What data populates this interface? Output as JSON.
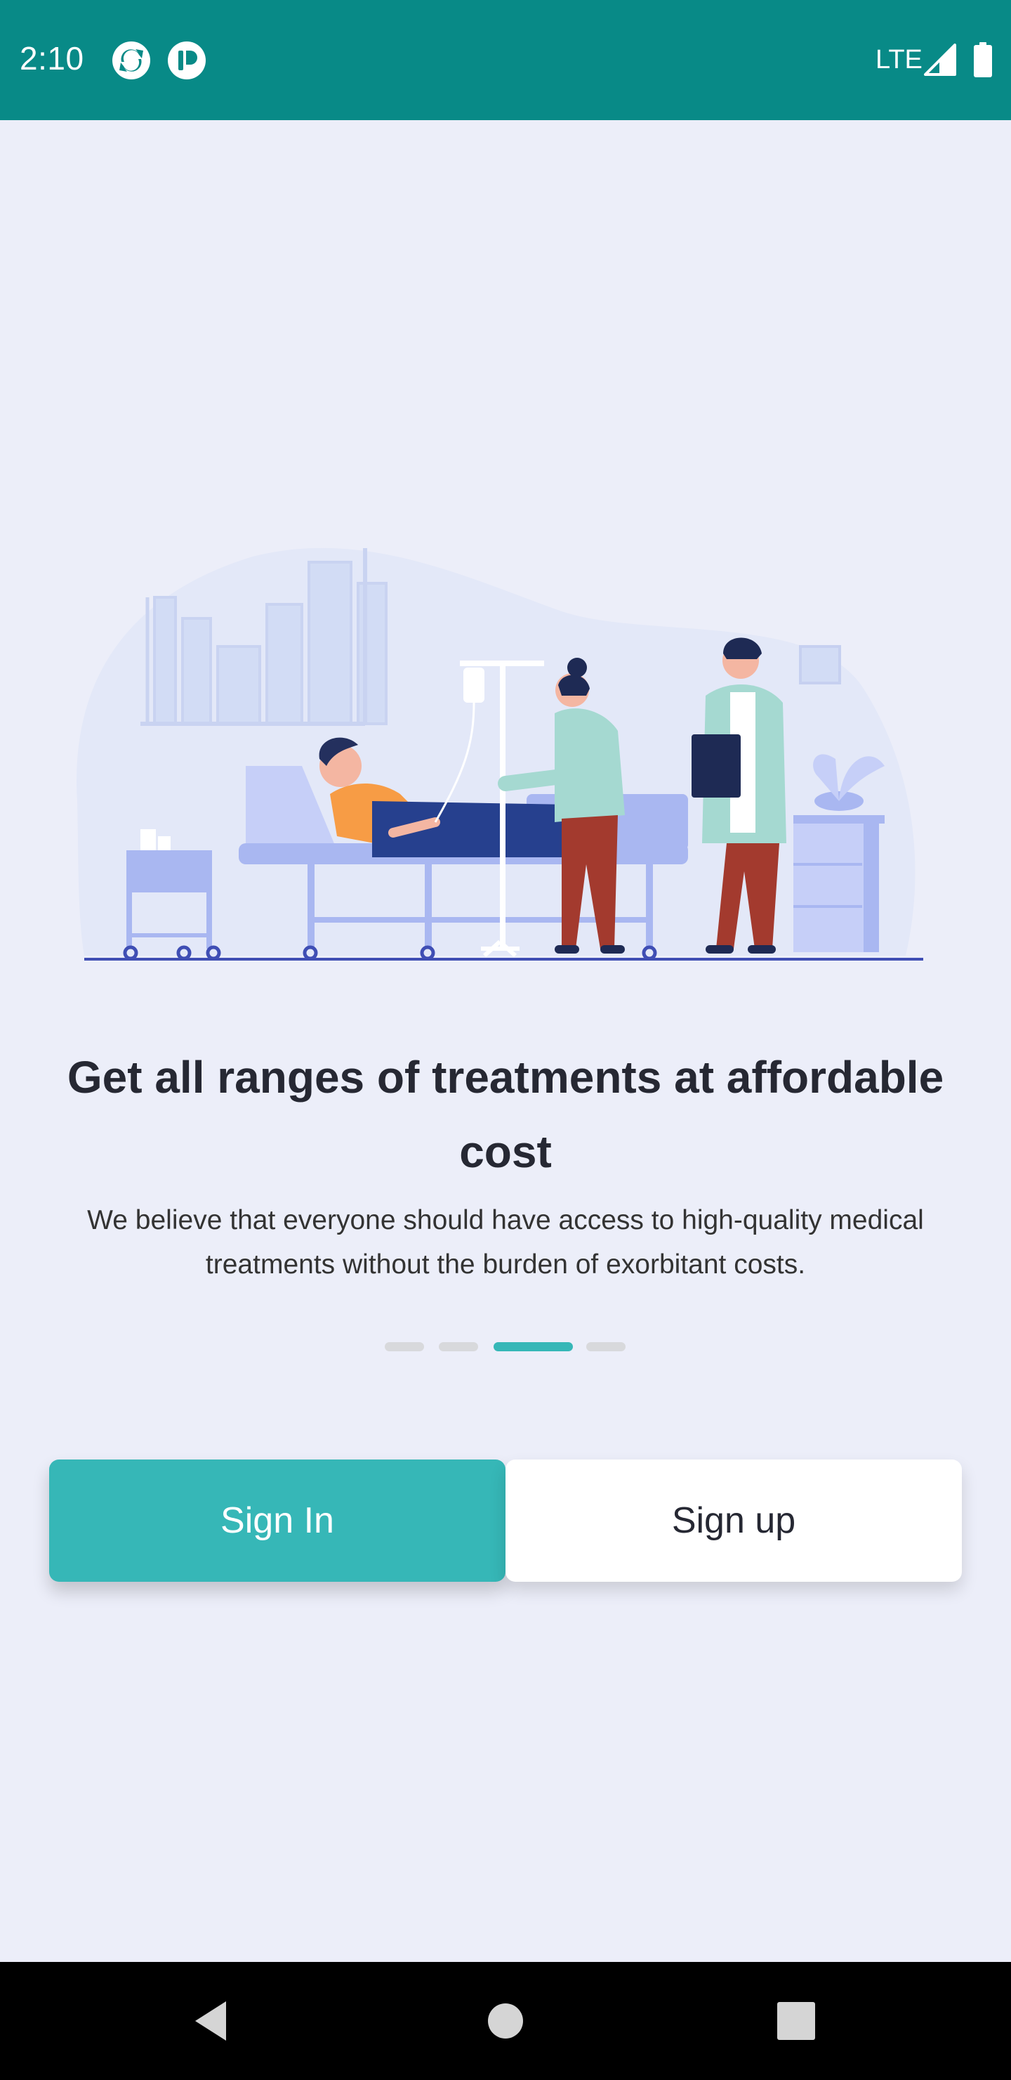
{
  "status_bar": {
    "time": "2:10",
    "network": "LTE",
    "icons": [
      "sync-app-icon",
      "pp-app-icon",
      "signal-icon",
      "battery-icon"
    ],
    "background": "#088A87"
  },
  "onboarding": {
    "illustration": "hospital-treatment-illustration",
    "headline": "Get all ranges of treatments at affordable cost",
    "description": "We believe that everyone should have access to high-quality medical treatments without the burden of exorbitant costs.",
    "pager": {
      "total": 4,
      "active_index": 2
    }
  },
  "actions": {
    "sign_in_label": "Sign In",
    "sign_up_label": "Sign up"
  },
  "colors": {
    "accent": "#36B7B7",
    "background": "#ECEEF9",
    "headline": "#262833"
  },
  "nav_bar": {
    "icons": [
      "back-icon",
      "home-icon",
      "recents-icon"
    ]
  }
}
